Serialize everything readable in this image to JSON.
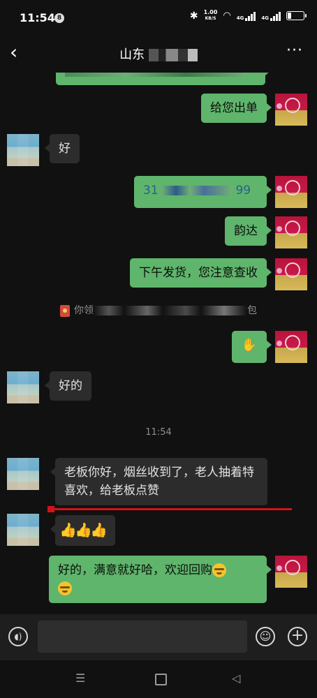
{
  "status_bar": {
    "time": "11:54",
    "notification_badge": "8",
    "net_speed_value": "1.00",
    "net_speed_unit": "KB/S",
    "net_label_1": "4G",
    "net_label_2": "4G",
    "battery_level": 0.2
  },
  "header": {
    "title_visible": "山东",
    "back_icon": "chevron-left-icon",
    "more_icon": "more-dots-icon"
  },
  "messages": [
    {
      "side": "right",
      "text": "给您出单"
    },
    {
      "side": "left",
      "text": "好"
    },
    {
      "side": "right",
      "text_prefix": "31",
      "text_suffix": "99"
    },
    {
      "side": "right",
      "text": "韵达"
    },
    {
      "side": "right",
      "text": "下午发货，您注意查收"
    },
    {
      "side": "right",
      "emoji": "handshake-emoji"
    },
    {
      "side": "left",
      "text": "好的"
    },
    {
      "side": "left",
      "text": "老板你好，烟丝收到了，老人抽着特喜欢，给老板点赞"
    },
    {
      "side": "left",
      "emoji": "thumbs-up-x3"
    },
    {
      "side": "right",
      "text": "好的，满意就好哈，欢迎回购"
    }
  ],
  "system_note": {
    "prefix": "你领",
    "suffix": "包"
  },
  "timestamp": "11:54",
  "input_bar": {
    "placeholder": "",
    "voice_icon": "voice-icon",
    "emoji_icon": "emoji-icon",
    "add_icon": "plus-icon"
  },
  "nav_bar": {
    "menu_icon": "menu-icon",
    "home_icon": "home-icon",
    "back_icon": "back-triangle-icon"
  },
  "colors": {
    "outgoing_bubble": "#5fb56b",
    "incoming_bubble": "#2c2c2c",
    "background": "#111111",
    "annotation_line": "#d0131b"
  }
}
